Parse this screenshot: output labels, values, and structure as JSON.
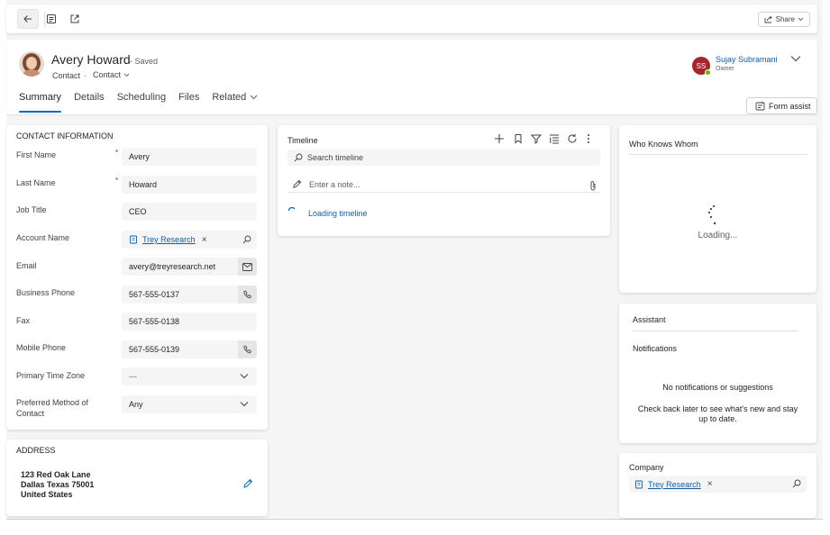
{
  "toolbar": {
    "back_icon": "arrow-left-icon",
    "form_icon": "form-icon",
    "popout_icon": "open-in-new-window-icon",
    "share_label": "Share"
  },
  "record": {
    "name": "Avery Howard",
    "saved_status": "- Saved",
    "entity": "Contact",
    "separator": "·",
    "form_selector": "Contact"
  },
  "owner": {
    "initials": "SS",
    "name": "Sujay Subramani",
    "role": "Owner",
    "avatar_color": "#a4262c",
    "presence_color": "#6bb700"
  },
  "tabs": [
    {
      "label": "Summary",
      "active": true
    },
    {
      "label": "Details",
      "active": false
    },
    {
      "label": "Scheduling",
      "active": false
    },
    {
      "label": "Files",
      "active": false
    },
    {
      "label": "Related",
      "active": false
    }
  ],
  "form_assist_label": "Form assist",
  "contact_info": {
    "title": "CONTACT INFORMATION",
    "required_mark": "*",
    "first_name": {
      "label": "First Name",
      "value": "Avery"
    },
    "last_name": {
      "label": "Last Name",
      "value": "Howard"
    },
    "job_title": {
      "label": "Job Title",
      "value": "CEO"
    },
    "account_name": {
      "label": "Account Name",
      "value": "Trey Research",
      "remove": "×"
    },
    "email": {
      "label": "Email",
      "value": "avery@treyresearch.net"
    },
    "business_phone": {
      "label": "Business Phone",
      "value": "567-555-0137"
    },
    "fax": {
      "label": "Fax",
      "value": "567-555-0138"
    },
    "mobile_phone": {
      "label": "Mobile Phone",
      "value": "567-555-0139"
    },
    "time_zone": {
      "label": "Primary Time Zone",
      "value": "---"
    },
    "preferred_contact": {
      "label": "Preferred Method of Contact",
      "value": "Any"
    }
  },
  "address": {
    "title": "ADDRESS",
    "line1": "123 Red Oak Lane",
    "line2": "Dallas Texas 75001",
    "line3": "United States"
  },
  "timeline": {
    "title": "Timeline",
    "search_placeholder": "Search timeline",
    "note_placeholder": "Enter a note...",
    "loading_text": "Loading timeline"
  },
  "who_knows_whom": {
    "title": "Who Knows Whom",
    "loading_text": "Loading..."
  },
  "assistant": {
    "title": "Assistant",
    "notifications_label": "Notifications",
    "empty_title": "No notifications or suggestions",
    "empty_message": "Check back later to see what's new and stay up to date."
  },
  "company": {
    "label": "Company",
    "value": "Trey Research",
    "remove": "×"
  },
  "colors": {
    "accent": "#0f6cbd",
    "link": "#115ea3",
    "required": "#c50f1f"
  }
}
